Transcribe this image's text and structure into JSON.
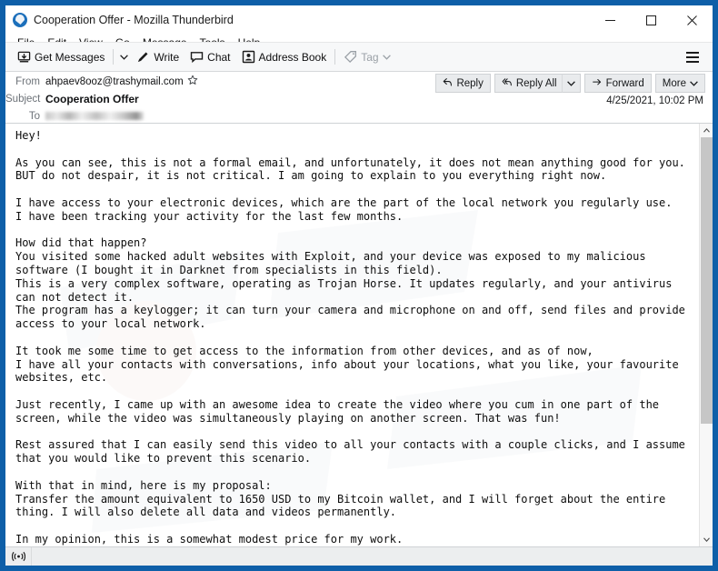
{
  "window": {
    "title": "Cooperation Offer - Mozilla Thunderbird",
    "app_icon": "thunderbird-icon",
    "minimize_label": "—",
    "maximize_label": "☐",
    "close_label": "✕",
    "accent_color": "#0e5fa8"
  },
  "menubar": {
    "items": [
      {
        "label": "File"
      },
      {
        "label": "Edit"
      },
      {
        "label": "View"
      },
      {
        "label": "Go"
      },
      {
        "label": "Message"
      },
      {
        "label": "Tools"
      },
      {
        "label": "Help"
      }
    ]
  },
  "toolbar": {
    "get_messages_label": "Get Messages",
    "get_messages_caret": "∨",
    "write_label": "Write",
    "chat_label": "Chat",
    "address_book_label": "Address Book",
    "tag_label": "Tag",
    "tag_caret": "∨",
    "app_menu_icon": "hamburger-icon"
  },
  "message_header": {
    "from_label": "From",
    "from_value": "ahpaev8ooz@trashymail.com",
    "star_icon": "star-outline-icon",
    "subject_label": "Subject",
    "subject_value": "Cooperation Offer",
    "to_label": "To",
    "to_value_redacted": true,
    "date": "4/25/2021, 10:02 PM",
    "actions": {
      "reply_label": "Reply",
      "reply_all_label": "Reply All",
      "reply_all_caret": "∨",
      "forward_label": "Forward",
      "more_label": "More",
      "more_caret": "∨"
    }
  },
  "message_body": {
    "text": "Hey!\n\nAs you can see, this is not a formal email, and unfortunately, it does not mean anything good for you.\nBUT do not despair, it is not critical. I am going to explain to you everything right now.\n\nI have access to your electronic devices, which are the part of the local network you regularly use.\nI have been tracking your activity for the last few months.\n\nHow did that happen?\nYou visited some hacked adult websites with Exploit, and your device was exposed to my malicious software (I bought it in Darknet from specialists in this field).\nThis is a very complex software, operating as Trojan Horse. It updates regularly, and your antivirus can not detect it.\nThe program has a keylogger; it can turn your camera and microphone on and off, send files and provide access to your local network.\n\nIt took me some time to get access to the information from other devices, and as of now,\nI have all your contacts with conversations, info about your locations, what you like, your favourite websites, etc.\n\nJust recently, I came up with an awesome idea to create the video where you cum in one part of the screen, while the video was simultaneously playing on another screen. That was fun!\n\nRest assured that I can easily send this video to all your contacts with a couple clicks, and I assume that you would like to prevent this scenario.\n\nWith that in mind, here is my proposal:\nTransfer the amount equivalent to 1650 USD to my Bitcoin wallet, and I will forget about the entire thing. I will also delete all data and videos permanently.\n\nIn my opinion, this is a somewhat modest price for my work.\nIf you don't know how to use Bitcoins, search it in Bing or Google 'how can I purchase Bitcoins' or other stuff like that.\n"
  },
  "scrollbar": {
    "up_arrow": "∧",
    "down_arrow": "∨"
  },
  "statusbar": {
    "connection_icon": "network-activity-icon",
    "text": ""
  }
}
